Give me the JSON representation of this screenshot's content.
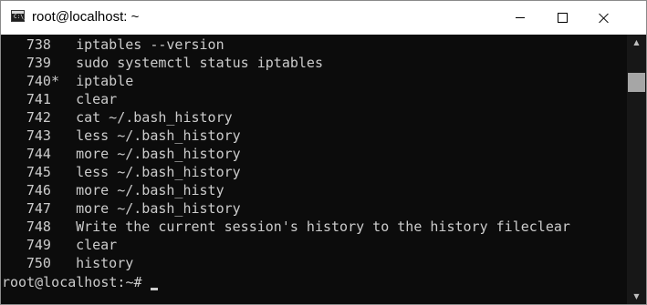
{
  "window": {
    "title": "root@localhost: ~",
    "icon": "terminal-app-icon",
    "icon_prompt": "C:\\_"
  },
  "controls": {
    "minimize_icon": "minimize-icon",
    "maximize_icon": "maximize-icon",
    "close_icon": "close-icon"
  },
  "history": [
    {
      "num": "738 ",
      "cmd": "iptables --version"
    },
    {
      "num": "739 ",
      "cmd": "sudo systemctl status iptables"
    },
    {
      "num": "740*",
      "cmd": "iptable"
    },
    {
      "num": "741 ",
      "cmd": "clear"
    },
    {
      "num": "742 ",
      "cmd": "cat ~/.bash_history"
    },
    {
      "num": "743 ",
      "cmd": "less ~/.bash_history"
    },
    {
      "num": "744 ",
      "cmd": "more ~/.bash_history"
    },
    {
      "num": "745 ",
      "cmd": "less ~/.bash_history"
    },
    {
      "num": "746 ",
      "cmd": "more ~/.bash_histy"
    },
    {
      "num": "747 ",
      "cmd": "more ~/.bash_history"
    },
    {
      "num": "748 ",
      "cmd": "Write the current session's history to the history fileclear"
    },
    {
      "num": "749 ",
      "cmd": "clear"
    },
    {
      "num": "750 ",
      "cmd": "history"
    }
  ],
  "prompt": "root@localhost:~#",
  "colors": {
    "background": "#0c0c0c",
    "foreground": "#cccccc",
    "titlebar": "#ffffff"
  }
}
